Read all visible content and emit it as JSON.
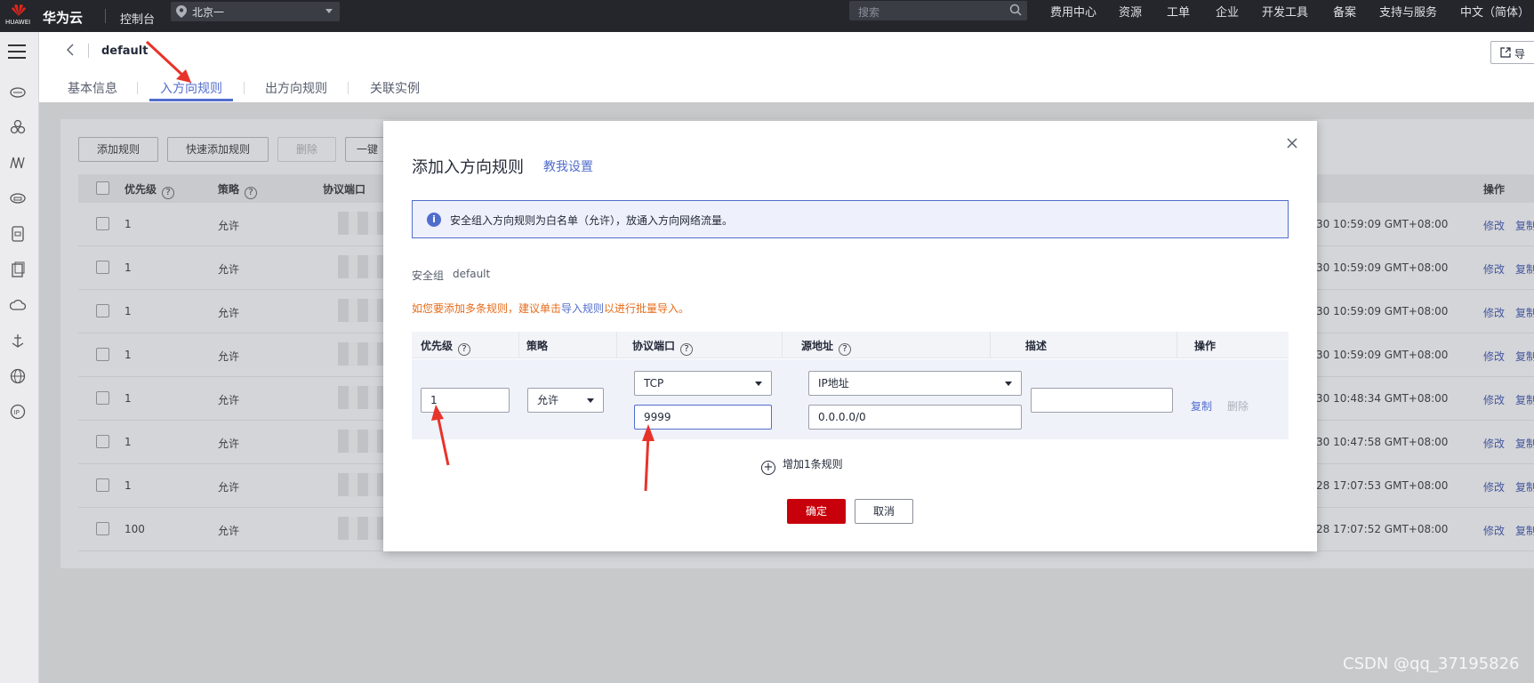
{
  "topbar": {
    "logo_text": "HUAWEI",
    "brand": "华为云",
    "console": "控制台",
    "region": "北京一",
    "search_placeholder": "搜索",
    "nav": [
      "费用中心",
      "资源",
      "工单",
      "企业",
      "开发工具",
      "备案",
      "支持与服务",
      "中文（简体）"
    ]
  },
  "header": {
    "title": "default",
    "tabs": [
      "基本信息",
      "入方向规则",
      "出方向规则",
      "关联实例"
    ],
    "active_tab": "入方向规则",
    "export_label": "导"
  },
  "background": {
    "buttons": [
      "添加规则",
      "快速添加规则",
      "删除",
      "一键"
    ],
    "columns": [
      "优先级",
      "策略",
      "协议端口",
      "操作"
    ],
    "rows": [
      {
        "priority": "1",
        "policy": "允许",
        "time": "30 10:59:09 GMT+08:00"
      },
      {
        "priority": "1",
        "policy": "允许",
        "time": "30 10:59:09 GMT+08:00"
      },
      {
        "priority": "1",
        "policy": "允许",
        "time": "30 10:59:09 GMT+08:00"
      },
      {
        "priority": "1",
        "policy": "允许",
        "time": "30 10:59:09 GMT+08:00"
      },
      {
        "priority": "1",
        "policy": "允许",
        "time": "30 10:48:34 GMT+08:00"
      },
      {
        "priority": "1",
        "policy": "允许",
        "time": "30 10:47:58 GMT+08:00"
      },
      {
        "priority": "1",
        "policy": "允许",
        "time": "28 17:07:53 GMT+08:00"
      },
      {
        "priority": "100",
        "policy": "允许",
        "time": "28 17:07:52 GMT+08:00"
      }
    ],
    "row_actions": [
      "修改",
      "复制"
    ]
  },
  "modal": {
    "title": "添加入方向规则",
    "help_link": "教我设置",
    "info": "安全组入方向规则为白名单（允许），放通入方向网络流量。",
    "sg_label": "安全组",
    "sg_value": "default",
    "tip_prefix": "如您要添加多条规则，建议单击",
    "tip_link": "导入规则",
    "tip_suffix": "以进行批量导入。",
    "columns": [
      "优先级",
      "策略",
      "协议端口",
      "源地址",
      "描述",
      "操作"
    ],
    "row": {
      "priority": "1",
      "policy": "允许",
      "protocol": "TCP",
      "port": "9999",
      "source_type": "IP地址",
      "source": "0.0.0.0/0",
      "description": "",
      "copy": "复制",
      "delete": "删除"
    },
    "add_one": "增加1条规则",
    "confirm": "确定",
    "cancel": "取消"
  },
  "watermark": "CSDN @qq_37195826",
  "colors": {
    "accent": "#526ecc",
    "primary_button": "#c7000b",
    "tip": "#e66c1a",
    "annotation_arrow": "#e8332a"
  }
}
